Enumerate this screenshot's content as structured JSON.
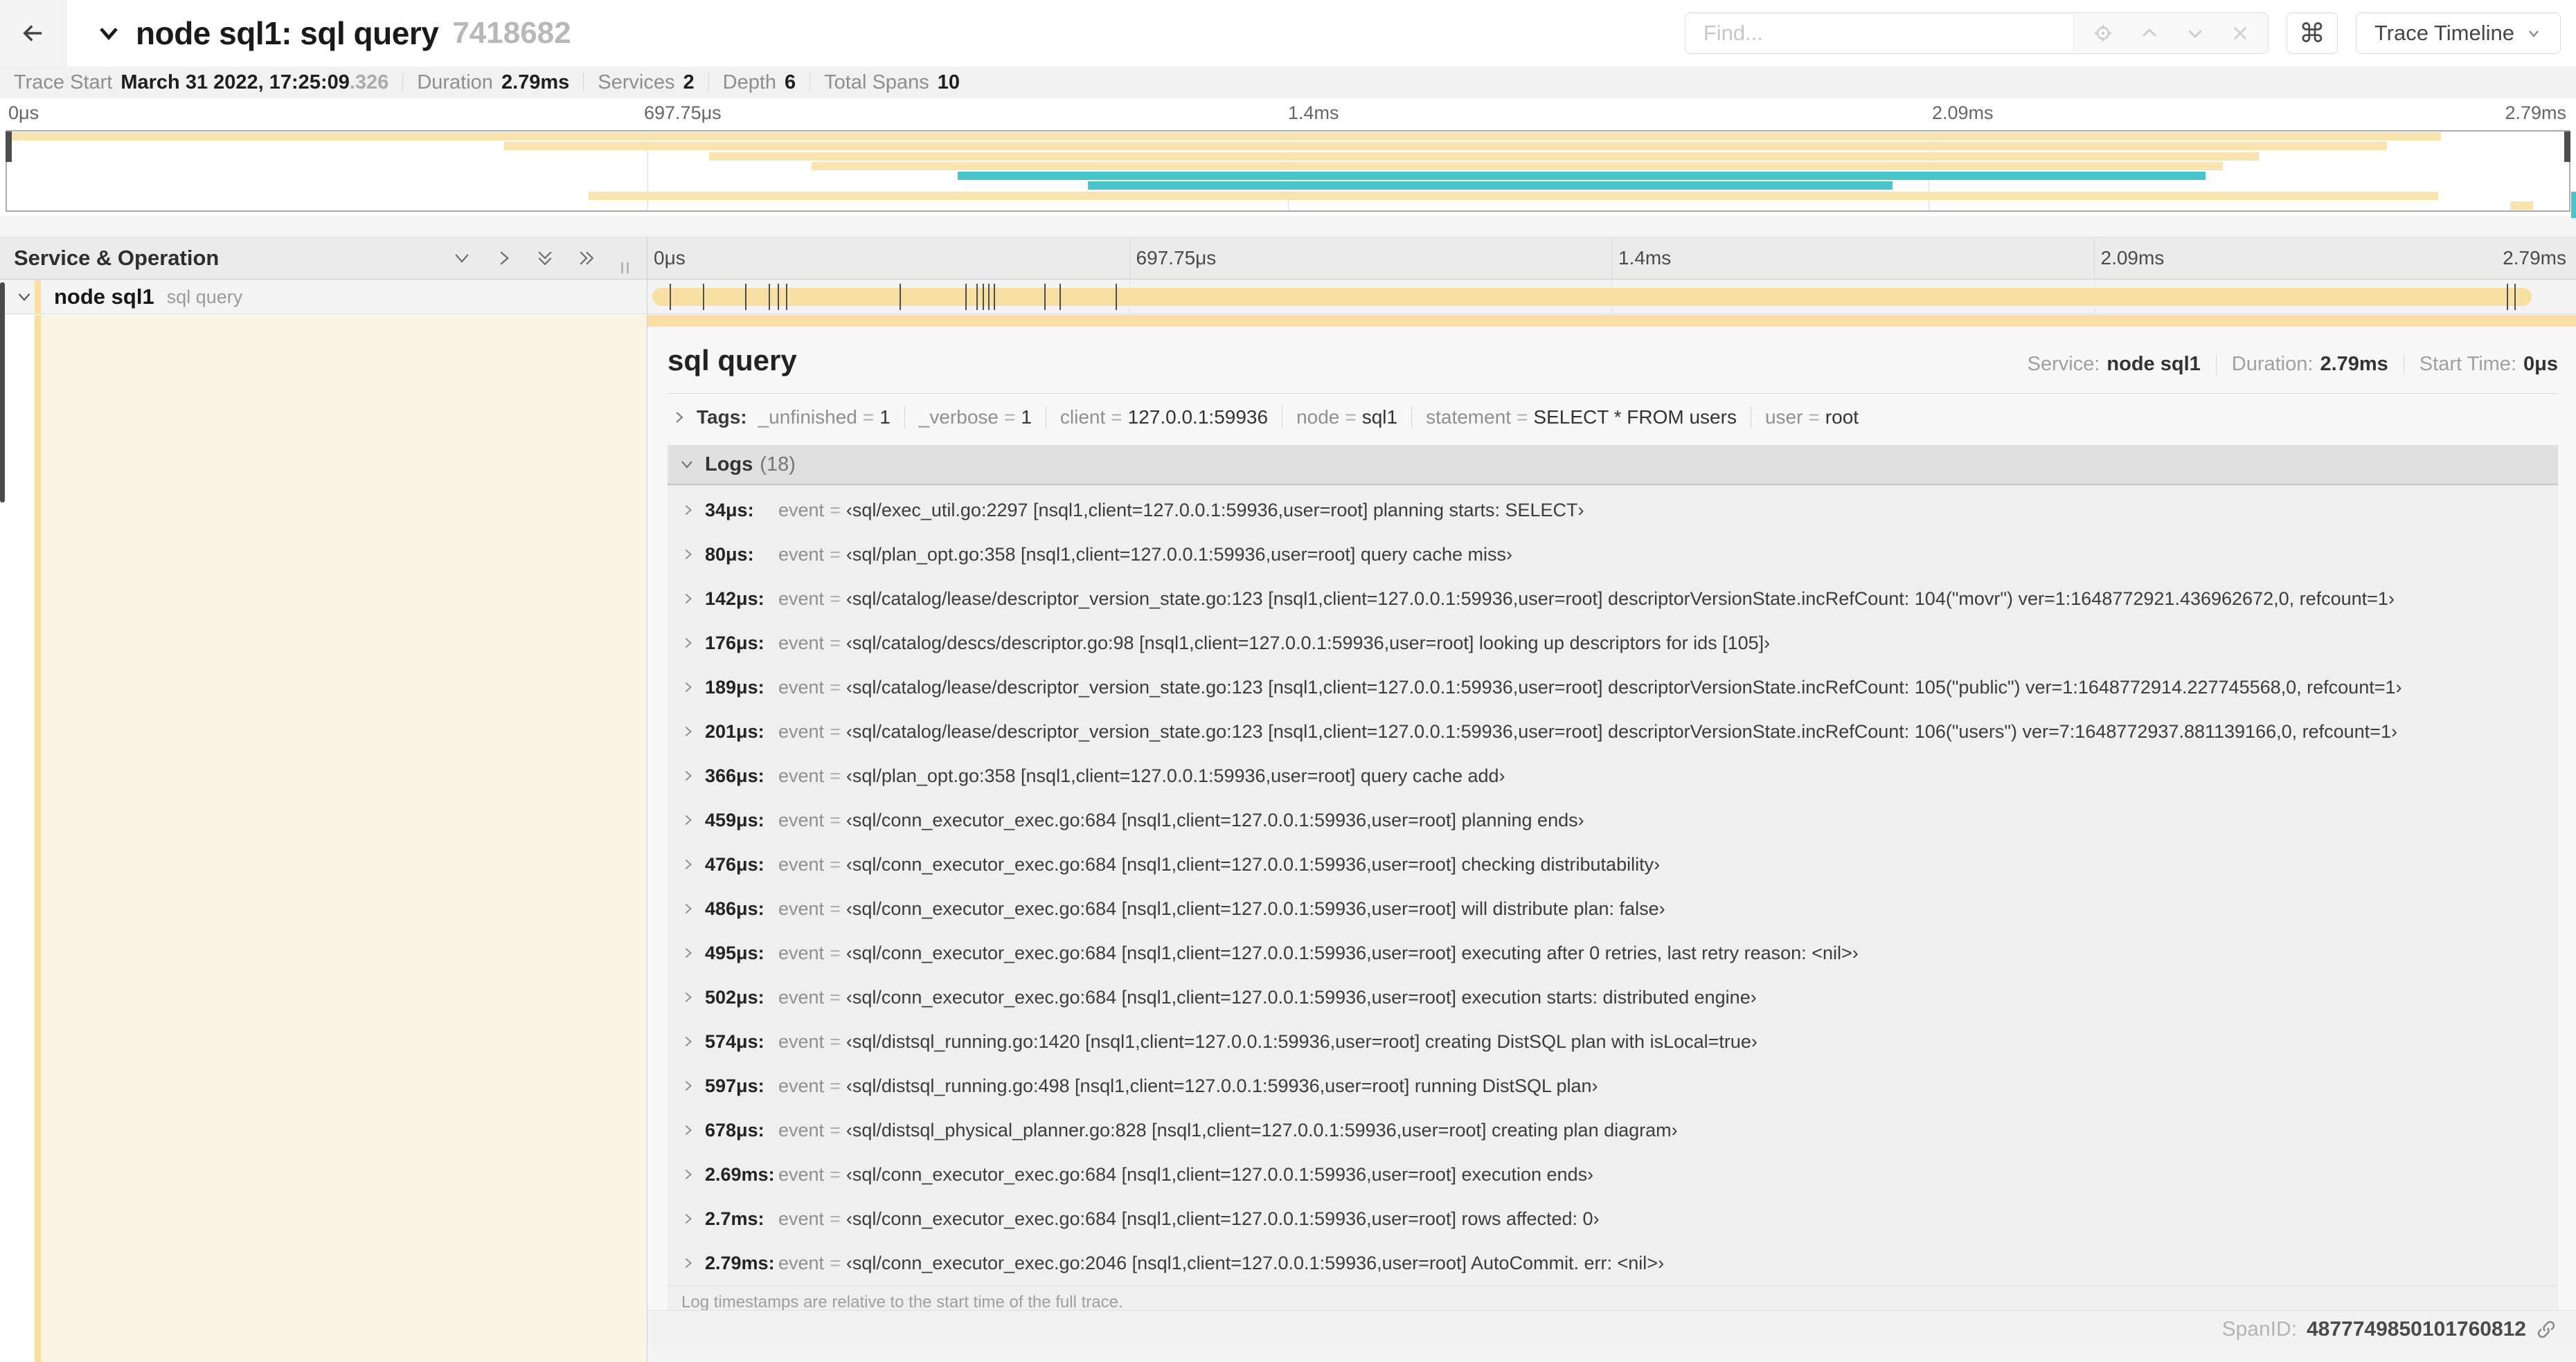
{
  "header": {
    "title": "node sql1: sql query",
    "trace_id": "7418682",
    "find_placeholder": "Find...",
    "view_selector_label": "Trace Timeline"
  },
  "icons": {
    "command": "⌘"
  },
  "summary": {
    "trace_start_label": "Trace Start",
    "trace_start": "March 31 2022, 17:25:09",
    "trace_start_fraction": ".326",
    "duration_label": "Duration",
    "duration": "2.79ms",
    "services_label": "Services",
    "services": "2",
    "depth_label": "Depth",
    "depth": "6",
    "total_spans_label": "Total Spans",
    "total_spans": "10"
  },
  "timeline": {
    "ticks": [
      "0μs",
      "697.75μs",
      "1.4ms",
      "2.09ms",
      "2.79ms"
    ]
  },
  "minimap": {
    "bars": [
      {
        "row": 0,
        "start": 0,
        "end": 95.0,
        "color": "minimap_tan"
      },
      {
        "row": 1,
        "start": 19.4,
        "end": 92.9,
        "color": "minimap_tan"
      },
      {
        "row": 2,
        "start": 27.4,
        "end": 87.9,
        "color": "minimap_tan"
      },
      {
        "row": 3,
        "start": 31.4,
        "end": 86.5,
        "color": "minimap_tan"
      },
      {
        "row": 4,
        "start": 37.1,
        "end": 85.8,
        "color": "span_teal"
      },
      {
        "row": 5,
        "start": 42.2,
        "end": 73.6,
        "color": "span_teal"
      },
      {
        "row": 6,
        "start": 22.7,
        "end": 94.9,
        "color": "minimap_tan"
      },
      {
        "row": 7,
        "start": 97.7,
        "end": 98.6,
        "color": "minimap_tan"
      }
    ]
  },
  "table": {
    "left_header": "Service & Operation"
  },
  "span_row": {
    "service": "node sql1",
    "operation": "sql query",
    "tick_positions": [
      1.2,
      2.9,
      5.1,
      6.3,
      6.8,
      7.2,
      13.1,
      16.5,
      17.1,
      17.4,
      17.7,
      18.0,
      20.6,
      21.4,
      24.3,
      96.4,
      96.8
    ]
  },
  "detail": {
    "operation": "sql query",
    "service_label": "Service:",
    "service": "node sql1",
    "duration_label": "Duration:",
    "duration": "2.79ms",
    "start_time_label": "Start Time:",
    "start_time": "0μs",
    "tags_label": "Tags:",
    "tags": [
      {
        "key": "_unfinished",
        "value": "1"
      },
      {
        "key": "_verbose",
        "value": "1"
      },
      {
        "key": "client",
        "value": "127.0.0.1:59936"
      },
      {
        "key": "node",
        "value": "sql1"
      },
      {
        "key": "statement",
        "value": "SELECT * FROM users"
      },
      {
        "key": "user",
        "value": "root"
      }
    ],
    "logs_label": "Logs",
    "logs_count": "(18)",
    "logs": [
      {
        "time": "34μs:",
        "field": "event",
        "value": "‹sql/exec_util.go:2297 [nsql1,client=127.0.0.1:59936,user=root] planning starts: SELECT›"
      },
      {
        "time": "80μs:",
        "field": "event",
        "value": "‹sql/plan_opt.go:358 [nsql1,client=127.0.0.1:59936,user=root] query cache miss›"
      },
      {
        "time": "142μs:",
        "field": "event",
        "value": "‹sql/catalog/lease/descriptor_version_state.go:123 [nsql1,client=127.0.0.1:59936,user=root] descriptorVersionState.incRefCount: 104(\"movr\") ver=1:1648772921.436962672,0, refcount=1›"
      },
      {
        "time": "176μs:",
        "field": "event",
        "value": "‹sql/catalog/descs/descriptor.go:98 [nsql1,client=127.0.0.1:59936,user=root] looking up descriptors for ids [105]›"
      },
      {
        "time": "189μs:",
        "field": "event",
        "value": "‹sql/catalog/lease/descriptor_version_state.go:123 [nsql1,client=127.0.0.1:59936,user=root] descriptorVersionState.incRefCount: 105(\"public\") ver=1:1648772914.227745568,0, refcount=1›"
      },
      {
        "time": "201μs:",
        "field": "event",
        "value": "‹sql/catalog/lease/descriptor_version_state.go:123 [nsql1,client=127.0.0.1:59936,user=root] descriptorVersionState.incRefCount: 106(\"users\") ver=7:1648772937.881139166,0, refcount=1›"
      },
      {
        "time": "366μs:",
        "field": "event",
        "value": "‹sql/plan_opt.go:358 [nsql1,client=127.0.0.1:59936,user=root] query cache add›"
      },
      {
        "time": "459μs:",
        "field": "event",
        "value": "‹sql/conn_executor_exec.go:684 [nsql1,client=127.0.0.1:59936,user=root] planning ends›"
      },
      {
        "time": "476μs:",
        "field": "event",
        "value": "‹sql/conn_executor_exec.go:684 [nsql1,client=127.0.0.1:59936,user=root] checking distributability›"
      },
      {
        "time": "486μs:",
        "field": "event",
        "value": "‹sql/conn_executor_exec.go:684 [nsql1,client=127.0.0.1:59936,user=root] will distribute plan: false›"
      },
      {
        "time": "495μs:",
        "field": "event",
        "value": "‹sql/conn_executor_exec.go:684 [nsql1,client=127.0.0.1:59936,user=root] executing after 0 retries, last retry reason: <nil>›"
      },
      {
        "time": "502μs:",
        "field": "event",
        "value": "‹sql/conn_executor_exec.go:684 [nsql1,client=127.0.0.1:59936,user=root] execution starts: distributed engine›"
      },
      {
        "time": "574μs:",
        "field": "event",
        "value": "‹sql/distsql_running.go:1420 [nsql1,client=127.0.0.1:59936,user=root] creating DistSQL plan with isLocal=true›"
      },
      {
        "time": "597μs:",
        "field": "event",
        "value": "‹sql/distsql_running.go:498 [nsql1,client=127.0.0.1:59936,user=root] running DistSQL plan›"
      },
      {
        "time": "678μs:",
        "field": "event",
        "value": "‹sql/distsql_physical_planner.go:828 [nsql1,client=127.0.0.1:59936,user=root] creating plan diagram›"
      },
      {
        "time": "2.69ms:",
        "field": "event",
        "value": "‹sql/conn_executor_exec.go:684 [nsql1,client=127.0.0.1:59936,user=root] execution ends›"
      },
      {
        "time": "2.7ms:",
        "field": "event",
        "value": "‹sql/conn_executor_exec.go:684 [nsql1,client=127.0.0.1:59936,user=root] rows affected: 0›"
      },
      {
        "time": "2.79ms:",
        "field": "event",
        "value": "‹sql/conn_executor_exec.go:2046 [nsql1,client=127.0.0.1:59936,user=root] AutoCommit. err: <nil>›"
      }
    ],
    "logs_footnote": "Log timestamps are relative to the start time of the full trace.",
    "spanid_label": "SpanID:",
    "spanid": "4877749850101760812"
  },
  "colors": {
    "span_tan": "#F8DFA4",
    "minimap_tan": "#F8E2AE",
    "span_teal": "#49C5C9",
    "detail_cream": "#FBF4E2"
  }
}
